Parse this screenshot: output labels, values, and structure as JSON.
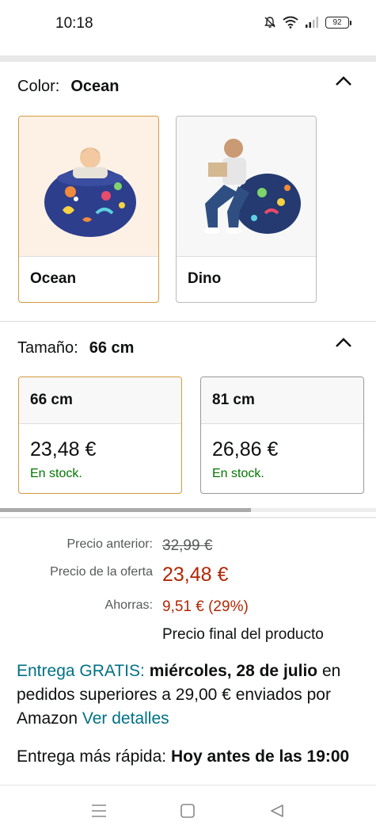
{
  "status_bar": {
    "time": "10:18",
    "battery": "92"
  },
  "color_section": {
    "label": "Color:",
    "selected": "Ocean",
    "options": [
      {
        "name": "Ocean"
      },
      {
        "name": "Dino"
      }
    ]
  },
  "size_section": {
    "label": "Tamaño:",
    "selected": "66 cm",
    "options": [
      {
        "size": "66 cm",
        "price": "23,48 €",
        "stock": "En stock."
      },
      {
        "size": "81 cm",
        "price": "26,86 €",
        "stock": "En stock."
      }
    ]
  },
  "pricing": {
    "previous_label": "Precio anterior:",
    "previous_value": "32,99 €",
    "offer_label": "Precio de la oferta",
    "offer_value": "23,48 €",
    "savings_label": "Ahorras:",
    "savings_value": "9,51 € (29%)",
    "final_note": "Precio final del producto"
  },
  "delivery": {
    "free_label": "Entrega GRATIS:",
    "date": "miércoles, 28 de julio",
    "condition": "en pedidos superiores a 29,00 € enviados por Amazon",
    "details_link": "Ver detalles",
    "fast_label": "Entrega más rápida:",
    "fast_value": "Hoy antes de las 19:00"
  },
  "colors": {
    "accent_border": "#d49a3e",
    "offer_red": "#b12704",
    "stock_green": "#007600",
    "link_teal": "#007185"
  }
}
